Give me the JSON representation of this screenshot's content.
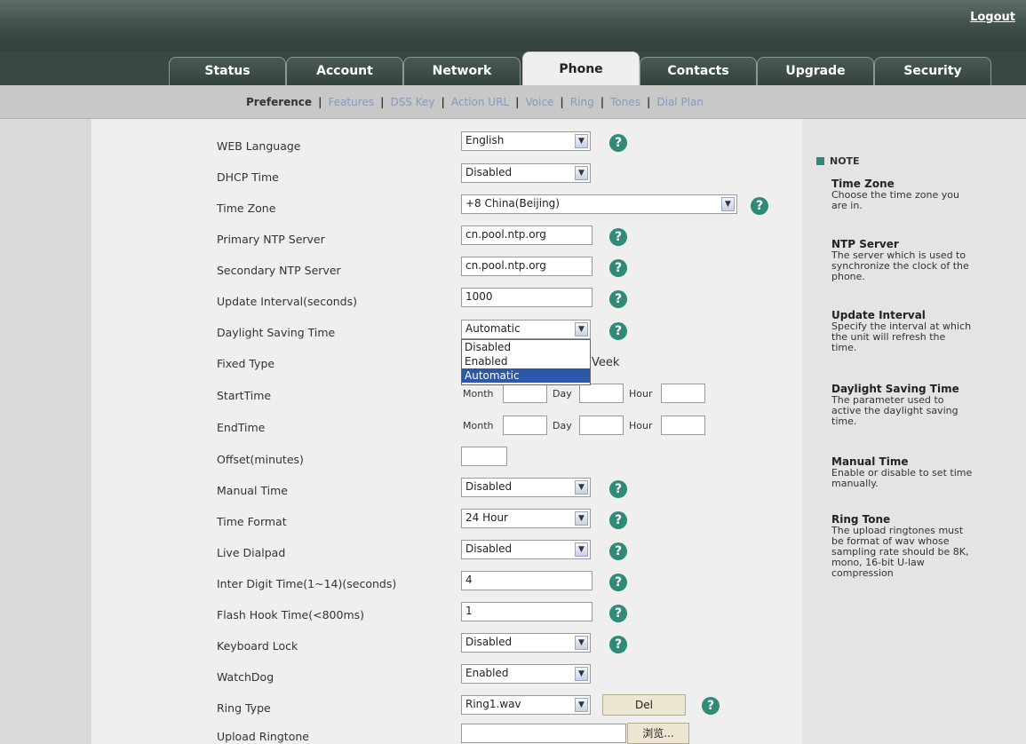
{
  "header": {
    "logout_label": "Logout"
  },
  "tabs": [
    {
      "label": "Status"
    },
    {
      "label": "Account"
    },
    {
      "label": "Network"
    },
    {
      "label": "Phone"
    },
    {
      "label": "Contacts"
    },
    {
      "label": "Upgrade"
    },
    {
      "label": "Security"
    }
  ],
  "active_tab": "Phone",
  "subnav": [
    {
      "label": "Preference"
    },
    {
      "label": "Features"
    },
    {
      "label": "DSS Key"
    },
    {
      "label": "Action URL"
    },
    {
      "label": "Voice"
    },
    {
      "label": "Ring"
    },
    {
      "label": "Tones"
    },
    {
      "label": "Dial Plan"
    }
  ],
  "form": {
    "web_language": {
      "label": "WEB Language",
      "value": "English"
    },
    "dhcp_time": {
      "label": "DHCP Time",
      "value": "Disabled"
    },
    "time_zone": {
      "label": "Time Zone",
      "value": "+8 China(Beijing)"
    },
    "primary_ntp": {
      "label": "Primary NTP Server",
      "value": "cn.pool.ntp.org"
    },
    "secondary_ntp": {
      "label": "Secondary NTP Server",
      "value": "cn.pool.ntp.org"
    },
    "update_interval": {
      "label": "Update Interval(seconds)",
      "value": "1000"
    },
    "daylight_saving": {
      "label": "Daylight Saving Time",
      "value": "Automatic",
      "options": [
        "Disabled",
        "Enabled",
        "Automatic"
      ]
    },
    "fixed_type": {
      "label": "Fixed Type",
      "value_tail": "Veek"
    },
    "start_time": {
      "label": "StartTime",
      "month": "Month",
      "day": "Day",
      "hour": "Hour"
    },
    "end_time": {
      "label": "EndTime",
      "month": "Month",
      "day": "Day",
      "hour": "Hour"
    },
    "offset": {
      "label": "Offset(minutes)",
      "value": ""
    },
    "manual_time": {
      "label": "Manual Time",
      "value": "Disabled"
    },
    "time_format": {
      "label": "Time Format",
      "value": "24 Hour"
    },
    "live_dialpad": {
      "label": "Live Dialpad",
      "value": "Disabled"
    },
    "inter_digit": {
      "label": "Inter Digit Time(1~14)(seconds)",
      "value": "4"
    },
    "flash_hook": {
      "label": "Flash Hook Time(<800ms)",
      "value": "1"
    },
    "keyboard_lock": {
      "label": "Keyboard Lock",
      "value": "Disabled"
    },
    "watchdog": {
      "label": "WatchDog",
      "value": "Enabled"
    },
    "ring_type": {
      "label": "Ring Type",
      "value": "Ring1.wav",
      "del_label": "Del"
    },
    "upload_ringtone": {
      "label": "Upload Ringtone",
      "browse_label": "浏览..."
    }
  },
  "notes": {
    "heading": "NOTE",
    "items": [
      {
        "title": "Time Zone",
        "text": "Choose the time zone you are in."
      },
      {
        "title": "NTP Server",
        "text": "The server which is used to synchronize the clock of the phone."
      },
      {
        "title": "Update Interval",
        "text": "Specify the interval at which the unit will refresh the time."
      },
      {
        "title": "Daylight Saving Time",
        "text": "The parameter used to active the daylight saving time."
      },
      {
        "title": "Manual Time",
        "text": "Enable or disable to set time manually."
      },
      {
        "title": "Ring Tone",
        "text": "The upload ringtones must be format of wav whose sampling rate should be 8K, mono, 16-bit U-law compression"
      }
    ]
  },
  "icons": {
    "help": "?",
    "dropdown_arrow": "▼"
  },
  "colors": {
    "header": "#3a4843",
    "help_icon": "#2f8a76",
    "selected_option": "#2b58a8"
  }
}
